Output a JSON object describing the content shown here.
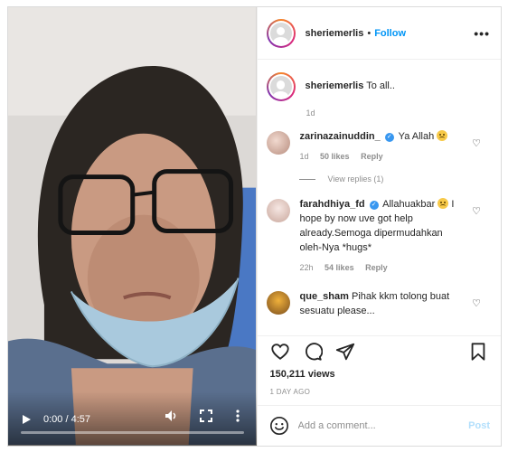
{
  "video": {
    "current_time": "0:00",
    "separator": " / ",
    "duration": "4:57",
    "progress_fraction": 0.0
  },
  "post": {
    "author": "sheriemerlis",
    "dot": "•",
    "follow_label": "Follow",
    "more_label": "•••",
    "caption_text": "To all..",
    "caption_age": "1d"
  },
  "comments": [
    {
      "user": "zarinazainuddin_",
      "verified": true,
      "text": "Ya Allah",
      "age": "1d",
      "likes": "50 likes",
      "reply_label": "Reply",
      "view_replies": "View replies (1)"
    },
    {
      "user": "farahdhiya_fd",
      "verified": true,
      "text_a": "Allahuakbar",
      "text_b": "I hope by now uve got help already.Semoga dipermudahkan oleh-Nya *hugs*",
      "age": "22h",
      "likes": "54 likes",
      "reply_label": "Reply"
    },
    {
      "user": "que_sham",
      "verified": false,
      "text": "Pihak kkm tolong buat sesuatu please..."
    }
  ],
  "actions": {
    "views": "150,211 views",
    "posted_ago": "1 DAY AGO"
  },
  "add_comment": {
    "placeholder": "Add a comment...",
    "post_label": "Post"
  },
  "colors": {
    "link_blue": "#0095f6",
    "muted": "#8e8e8e",
    "border": "#dbdbdb",
    "post_disabled": "#b2dffc"
  }
}
